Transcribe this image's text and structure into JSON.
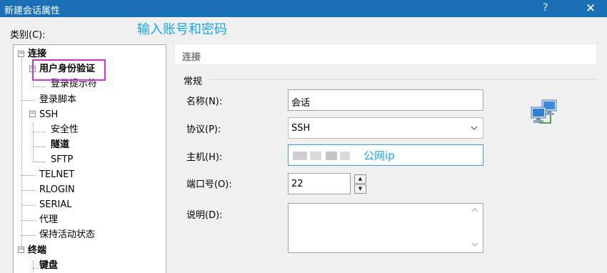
{
  "window": {
    "title": "新建会话属性",
    "help": "?",
    "close": "✕"
  },
  "category_label": "类别(C):",
  "annotation_top": "输入账号和密码",
  "annotation_host": "公网ip",
  "tree": {
    "items": [
      {
        "label": "连接",
        "bold": true
      },
      {
        "label": "用户身份验证",
        "bold": true
      },
      {
        "label": "登录提示符",
        "bold": false
      },
      {
        "label": "登录脚本",
        "bold": false
      },
      {
        "label": "SSH",
        "bold": false
      },
      {
        "label": "安全性",
        "bold": false
      },
      {
        "label": "隧道",
        "bold": true
      },
      {
        "label": "SFTP",
        "bold": false
      },
      {
        "label": "TELNET",
        "bold": false
      },
      {
        "label": "RLOGIN",
        "bold": false
      },
      {
        "label": "SERIAL",
        "bold": false
      },
      {
        "label": "代理",
        "bold": false
      },
      {
        "label": "保持活动状态",
        "bold": false
      },
      {
        "label": "终端",
        "bold": true
      },
      {
        "label": "键盘",
        "bold": true
      }
    ]
  },
  "panel": {
    "header": "连接",
    "group": "常规",
    "fields": {
      "name_label": "名称(N):",
      "name_value": "会话",
      "protocol_label": "协议(P):",
      "protocol_value": "SSH",
      "host_label": "主机(H):",
      "port_label": "端口号(O):",
      "port_value": "22",
      "desc_label": "说明(D):"
    }
  },
  "icons": {
    "network": "network-computers-icon",
    "dropdown": "chevron-down-icon",
    "spin_up": "spin-up-icon",
    "spin_down": "spin-down-icon"
  },
  "colors": {
    "titlebar": "#1b6fb5",
    "annotation": "#19a5e6",
    "highlight": "#d72dd7"
  }
}
